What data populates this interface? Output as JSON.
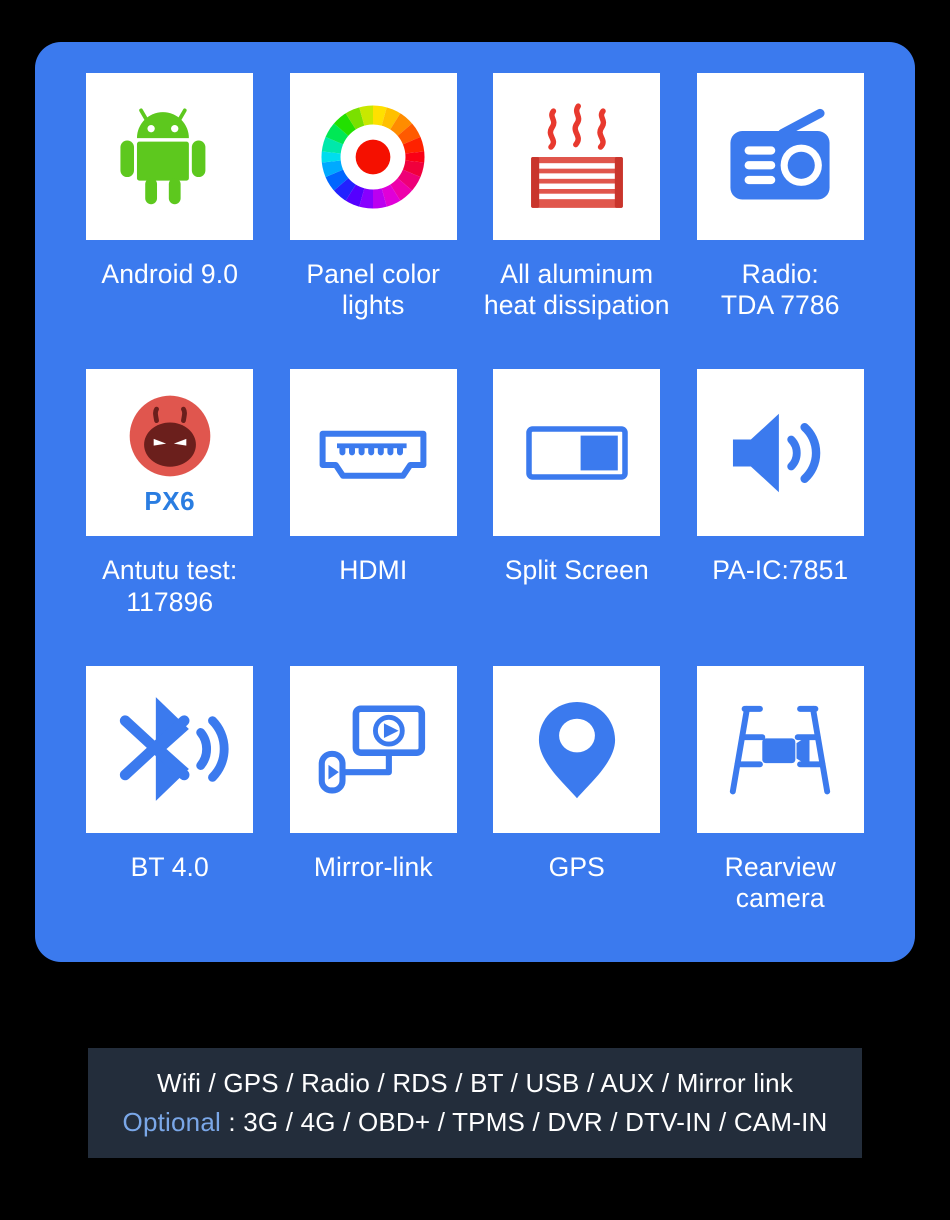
{
  "panel": {
    "background_color": "#3b7aee",
    "features": [
      {
        "id": "android",
        "icon": "android-robot-icon",
        "label": "Android 9.0"
      },
      {
        "id": "panel-lights",
        "icon": "color-wheel-icon",
        "label": "Panel color lights"
      },
      {
        "id": "heat",
        "icon": "heat-sink-icon",
        "label": "All aluminum\nheat dissipation"
      },
      {
        "id": "radio",
        "icon": "radio-icon",
        "label": "Radio:\nTDA 7786"
      },
      {
        "id": "antutu",
        "icon": "antutu-logo-icon",
        "label": "Antutu test:\n117896",
        "badge": "PX6"
      },
      {
        "id": "hdmi",
        "icon": "hdmi-port-icon",
        "label": "HDMI"
      },
      {
        "id": "split-screen",
        "icon": "split-screen-icon",
        "label": "Split Screen"
      },
      {
        "id": "pa-ic",
        "icon": "speaker-volume-icon",
        "label": "PA-IC:7851"
      },
      {
        "id": "bluetooth",
        "icon": "bluetooth-signal-icon",
        "label": "BT 4.0"
      },
      {
        "id": "mirror-link",
        "icon": "mirror-link-icon",
        "label": "Mirror-link"
      },
      {
        "id": "gps",
        "icon": "map-pin-icon",
        "label": "GPS"
      },
      {
        "id": "rearview",
        "icon": "rearview-camera-icon",
        "label": "Rearview camera"
      }
    ]
  },
  "spec_banner": {
    "background_color": "#232d3b",
    "line1": "Wifi / GPS / Radio / RDS / BT / USB / AUX / Mirror link",
    "optional_word": "Optional",
    "line2_rest": " : 3G / 4G / OBD+ / TPMS / DVR / DTV-IN / CAM-IN",
    "optional_color": "#7aa7e8"
  }
}
